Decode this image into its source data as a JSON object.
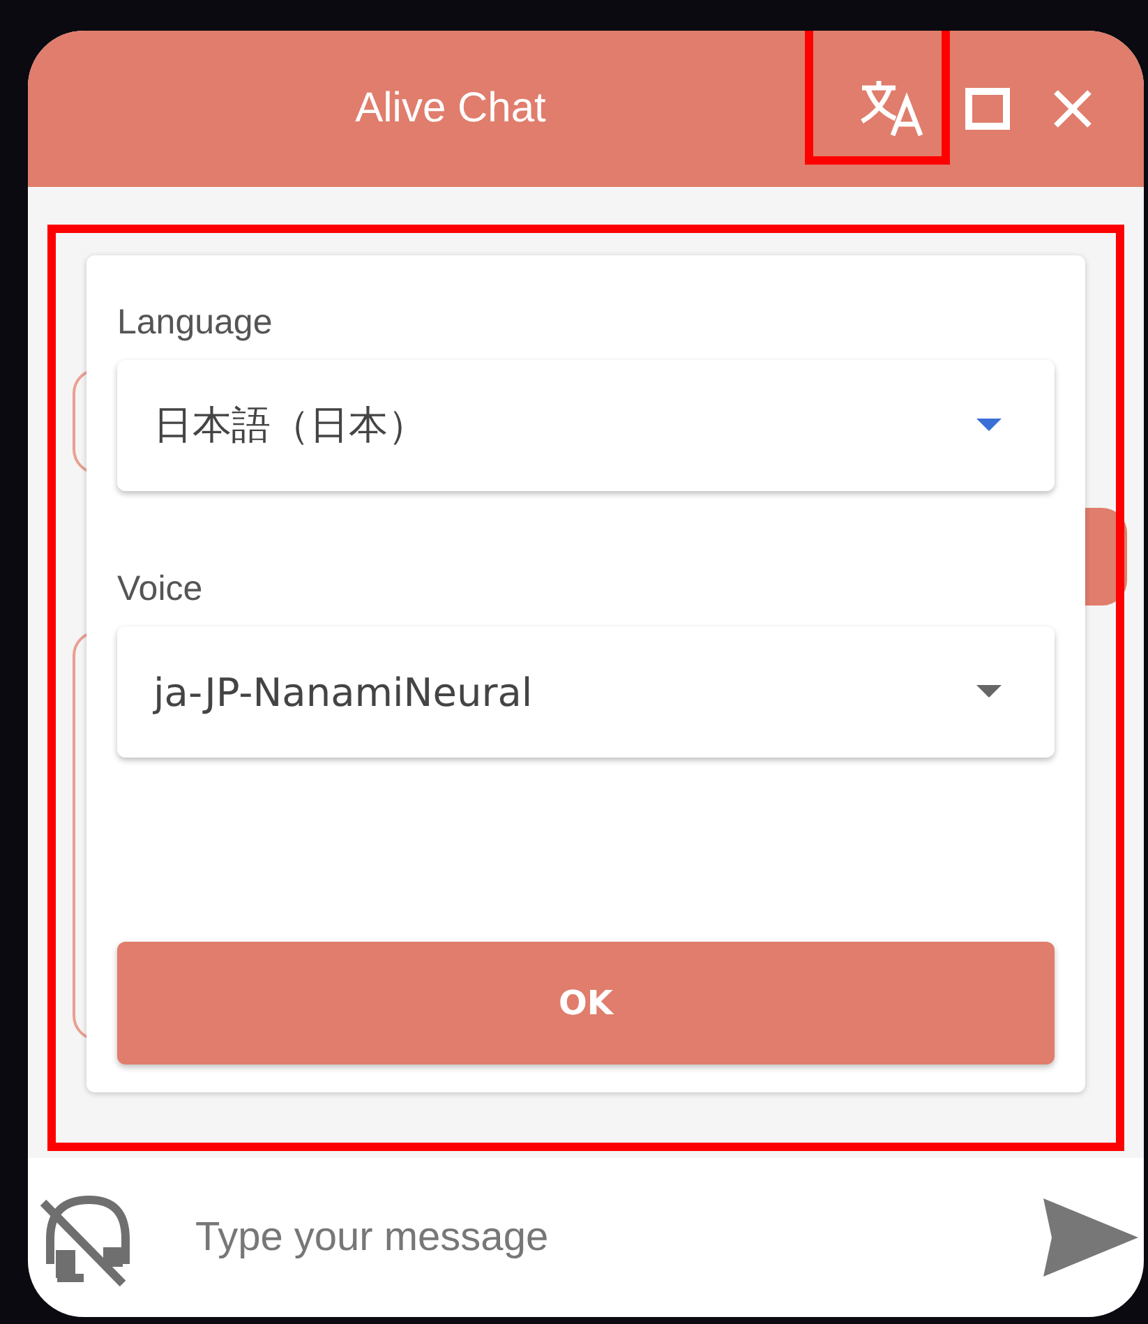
{
  "window": {
    "title": "Alive Chat"
  },
  "dialog": {
    "fields": [
      {
        "label": "Language",
        "value": "日本語（日本）",
        "focused": true
      },
      {
        "label": "Voice",
        "value": "ja-JP-NanamiNeural",
        "focused": false
      }
    ],
    "ok_button": "OK"
  },
  "composer": {
    "placeholder": "Type your message",
    "voice_disabled": true
  }
}
